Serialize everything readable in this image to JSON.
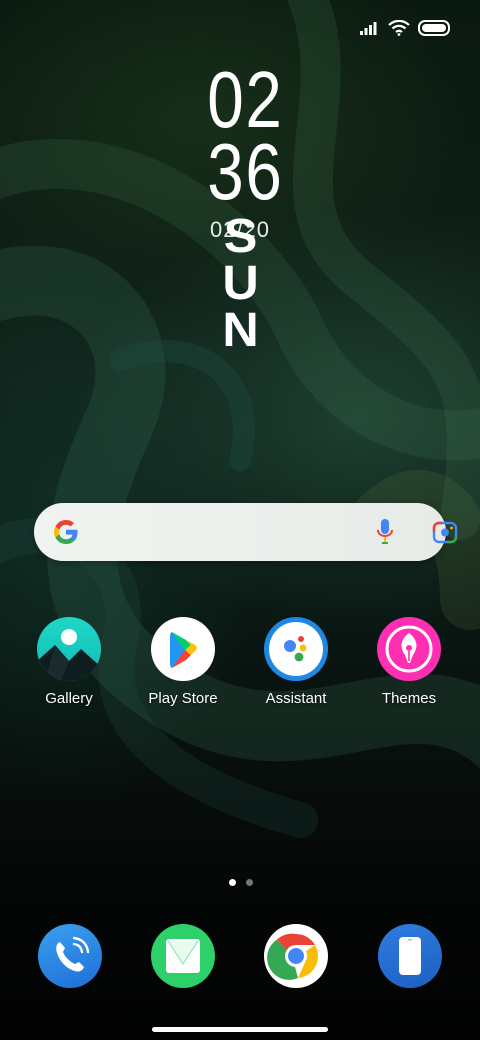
{
  "status_bar": {
    "signal_icon": "signal-icon",
    "wifi_icon": "wifi-icon",
    "battery_icon": "battery-icon"
  },
  "clock_widget": {
    "hours": "02",
    "minutes": "36",
    "date": "02/20",
    "day": "SUN"
  },
  "search_bar": {
    "logo_icon": "google-logo-icon",
    "mic_icon": "mic-icon",
    "lens_icon": "lens-icon"
  },
  "apps": [
    {
      "label": "Gallery",
      "icon": "gallery-icon"
    },
    {
      "label": "Play Store",
      "icon": "play-store-icon"
    },
    {
      "label": "Assistant",
      "icon": "assistant-icon"
    },
    {
      "label": "Themes",
      "icon": "themes-icon"
    }
  ],
  "page_indicator": {
    "pages": 2,
    "active": 1
  },
  "dock": [
    {
      "icon": "phone-icon"
    },
    {
      "icon": "messages-icon"
    },
    {
      "icon": "chrome-icon"
    },
    {
      "icon": "device-icon"
    }
  ],
  "colors": {
    "accent_green": "#2ed06a",
    "accent_blue": "#2196f3",
    "themes_pink": "#ff2fb4"
  }
}
